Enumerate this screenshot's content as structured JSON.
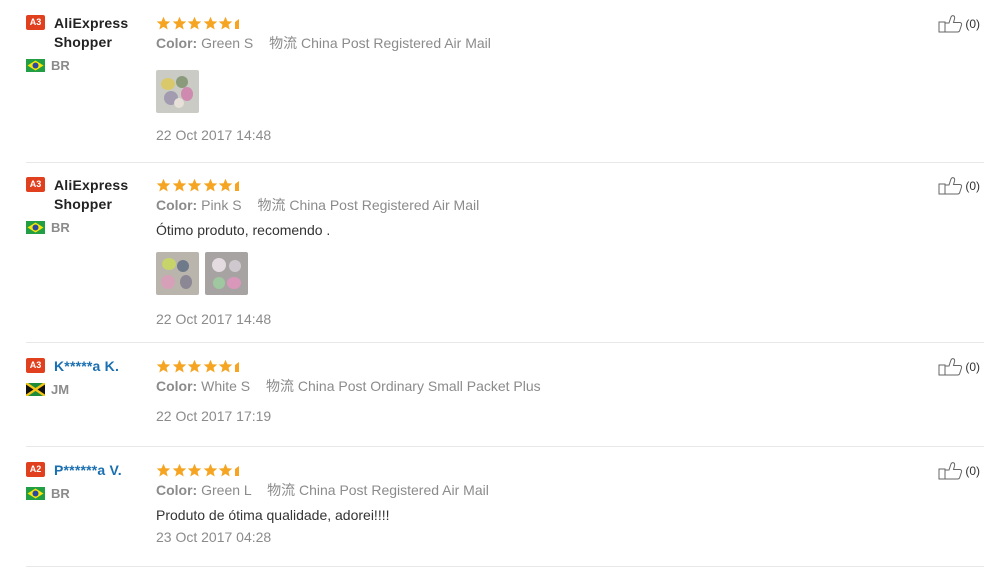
{
  "reviews": [
    {
      "level": "A3",
      "name": "AliExpress Shopper",
      "country": "BR",
      "flag": "br-flag-icon",
      "rating": 5,
      "color_label": "Color:",
      "color_value": "Green S",
      "logistics_label": "物流",
      "logistics_value": "China Post Registered Air Mail",
      "text": "",
      "photos": 1,
      "date": "22 Oct 2017 14:48",
      "helpful": "(0)"
    },
    {
      "level": "A3",
      "name": "AliExpress Shopper",
      "country": "BR",
      "flag": "br-flag-icon",
      "rating": 5,
      "color_label": "Color:",
      "color_value": "Pink S",
      "logistics_label": "物流",
      "logistics_value": "China Post Registered Air Mail",
      "text": "Ótimo produto, recomendo .",
      "photos": 2,
      "date": "22 Oct 2017 14:48",
      "helpful": "(0)"
    },
    {
      "level": "A3",
      "name": "K*****a K.",
      "country": "JM",
      "flag": "jm-flag-icon",
      "rating": 5,
      "color_label": "Color:",
      "color_value": "White S",
      "logistics_label": "物流",
      "logistics_value": "China Post Ordinary Small Packet Plus",
      "text": "",
      "photos": 0,
      "date": "22 Oct 2017 17:19",
      "helpful": "(0)"
    },
    {
      "level": "A2",
      "name": "P******a V.",
      "country": "BR",
      "flag": "br-flag-icon",
      "rating": 5,
      "color_label": "Color:",
      "color_value": "Green L",
      "logistics_label": "物流",
      "logistics_value": "China Post Registered Air Mail",
      "text": "Produto de ótima qualidade, adorei!!!!",
      "photos": 0,
      "date": "23 Oct 2017 04:28",
      "helpful": "(0)"
    }
  ],
  "colors": {
    "level_badge": "#e0401e",
    "star": "#f6a523",
    "link_name": "#1a6fb0",
    "muted": "#8b8b8b"
  }
}
